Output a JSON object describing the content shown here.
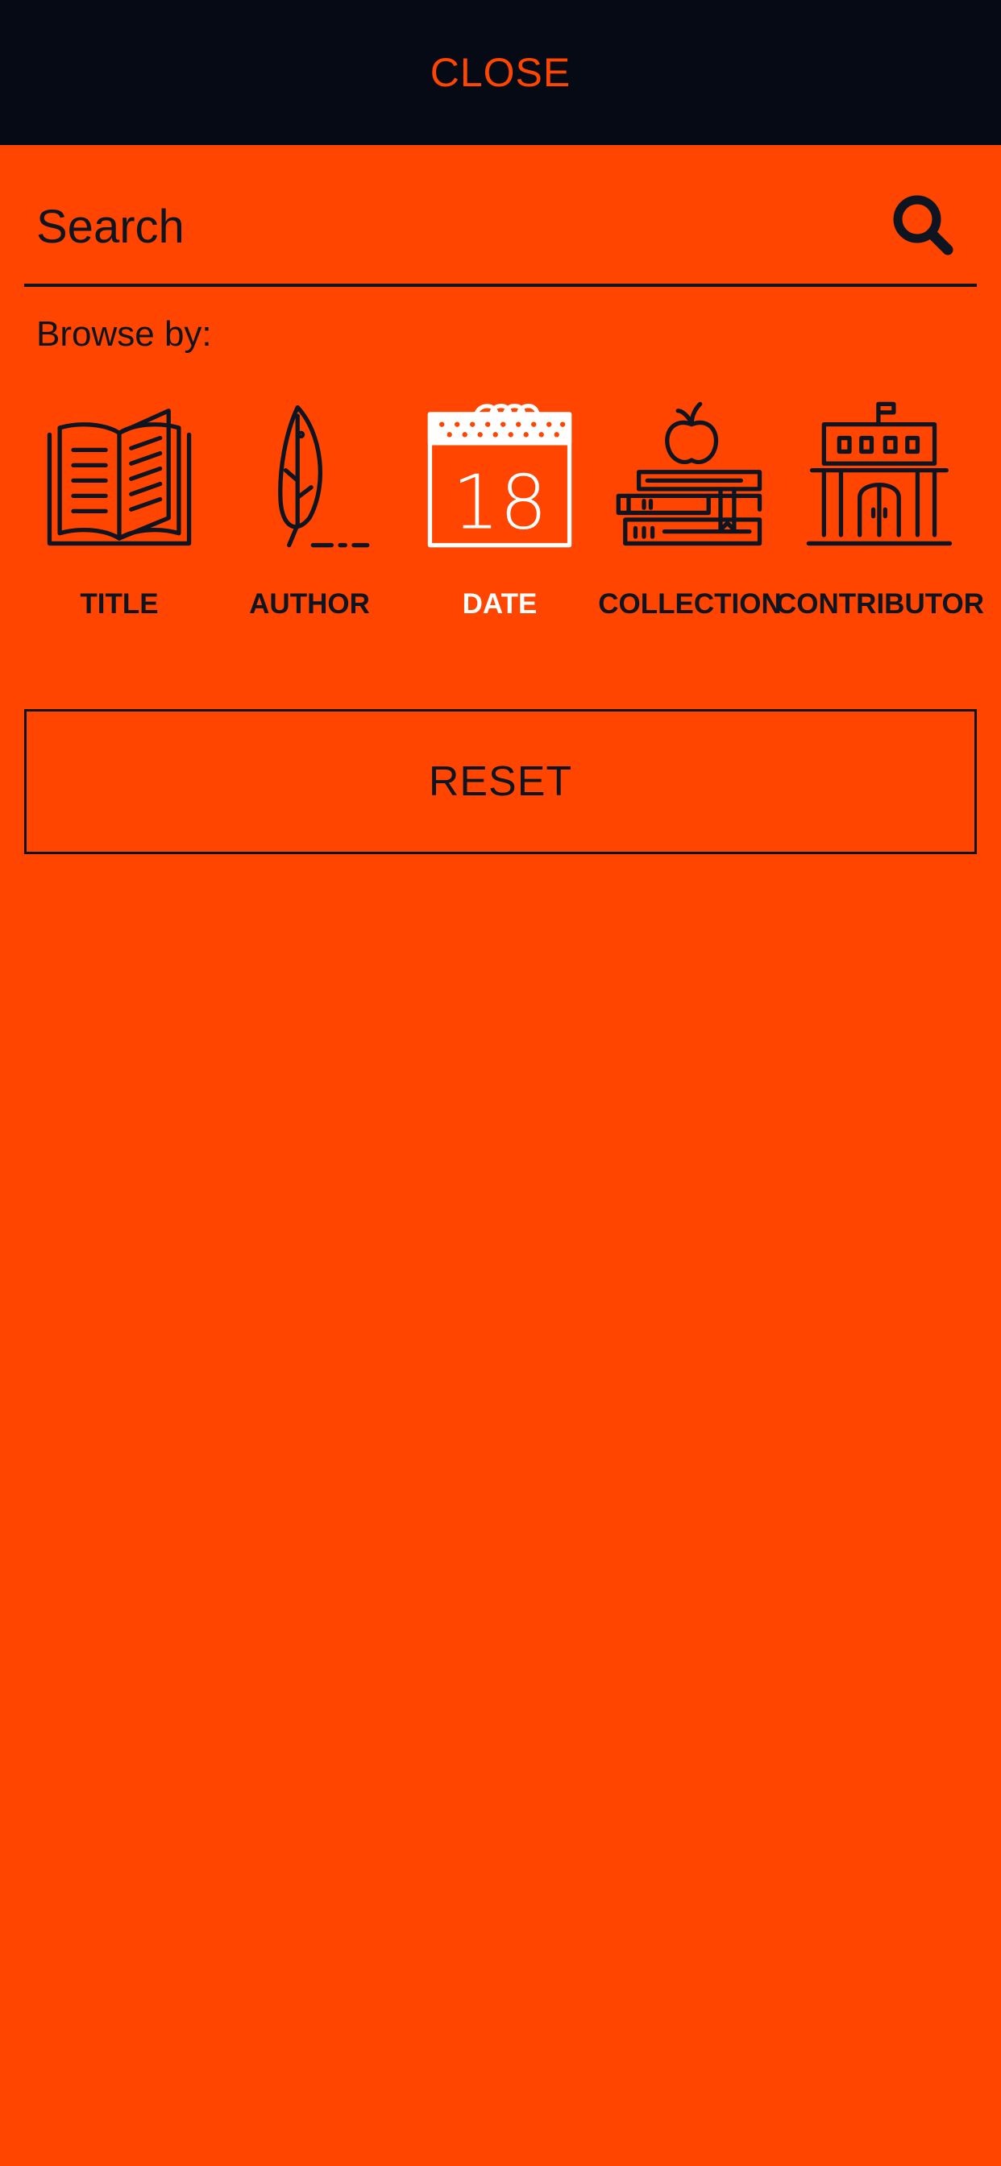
{
  "header": {
    "close_label": "CLOSE"
  },
  "search": {
    "placeholder": "Search",
    "icon": "search-icon"
  },
  "browse": {
    "label": "Browse by:",
    "items": [
      {
        "label": "TITLE",
        "icon": "open-book-icon",
        "active": false
      },
      {
        "label": "AUTHOR",
        "icon": "quill-feather-icon",
        "active": false
      },
      {
        "label": "DATE",
        "icon": "calendar-icon",
        "calendar_day": "18",
        "active": true
      },
      {
        "label": "COLLECTION",
        "icon": "books-apple-icon",
        "active": false
      },
      {
        "label": "CONTRIBUTOR",
        "icon": "building-icon",
        "active": false
      }
    ]
  },
  "reset": {
    "label": "RESET"
  },
  "colors": {
    "accent": "#FF4500",
    "header_bg": "#050A14",
    "ink": "#0F1520",
    "active": "#FFFFFF"
  }
}
